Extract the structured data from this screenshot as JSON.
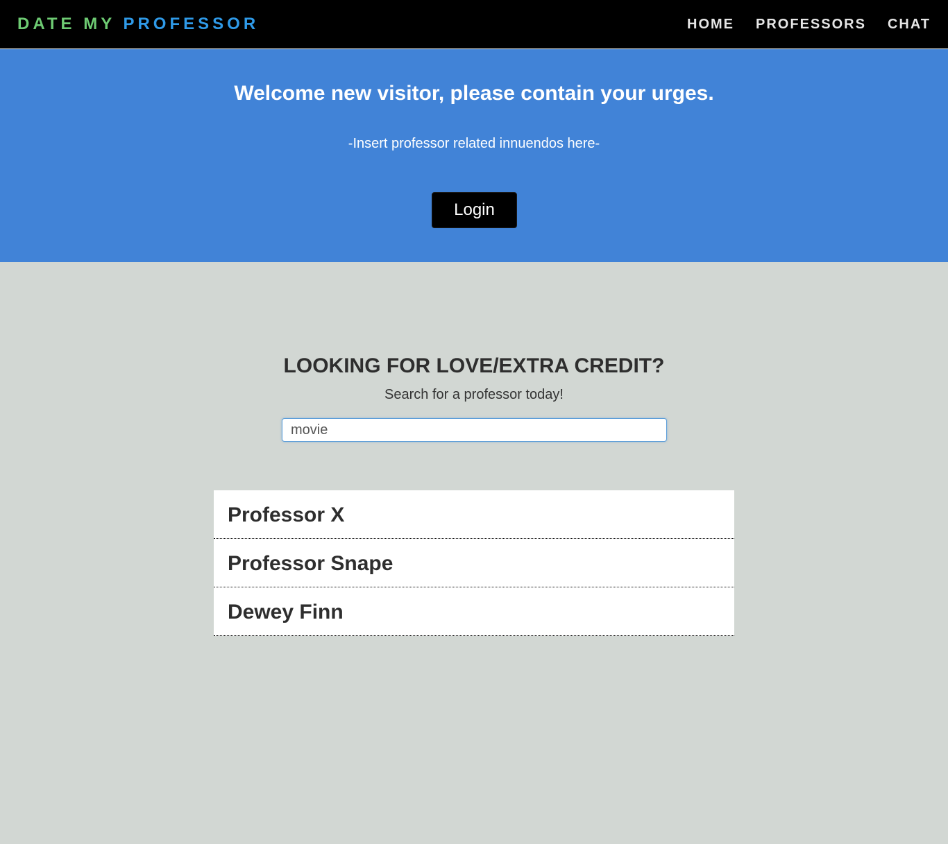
{
  "nav": {
    "brand_part1": "DATE MY",
    "brand_part2": "PROFESSOR",
    "links": [
      {
        "label": "HOME"
      },
      {
        "label": "PROFESSORS"
      },
      {
        "label": "CHAT"
      }
    ]
  },
  "hero": {
    "title": "Welcome new visitor, please contain your urges.",
    "subtitle": "-Insert professor related innuendos here-",
    "login_label": "Login"
  },
  "search": {
    "title": "LOOKING FOR LOVE/EXTRA CREDIT?",
    "subtitle": "Search for a professor today!",
    "value": "movie",
    "placeholder": ""
  },
  "results": [
    {
      "name": "Professor X"
    },
    {
      "name": "Professor Snape"
    },
    {
      "name": "Dewey Finn"
    }
  ],
  "colors": {
    "navbar_bg": "#000000",
    "brand_green": "#6ecb73",
    "brand_blue": "#2f9ae8",
    "hero_bg": "#4183d7",
    "page_bg": "#d2d7d3"
  }
}
